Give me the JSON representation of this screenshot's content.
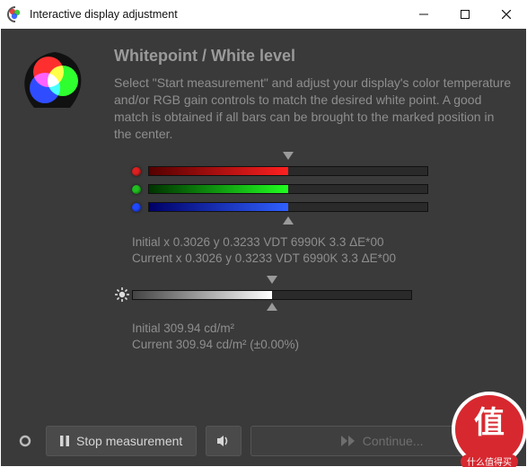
{
  "window": {
    "title": "Interactive display adjustment"
  },
  "heading": "Whitepoint / White level",
  "description": "Select \"Start measurement\" and adjust your display's color temperature and/or RGB gain controls to match the desired white point. A good match is obtained if all bars can be brought to the marked position in the center.",
  "rgb_bars": {
    "red_pct": 50,
    "green_pct": 50,
    "blue_pct": 50
  },
  "whitepoint_readings": {
    "initial": "Initial x 0.3026 y 0.3233 VDT 6990K 3.3 ΔE*00",
    "current": "Current x 0.3026 y 0.3233 VDT 6990K 3.3 ΔE*00"
  },
  "luminance_bar": {
    "pct": 50
  },
  "luminance_readings": {
    "initial": "Initial 309.94 cd/m²",
    "current": "Current 309.94 cd/m² (±0.00%)"
  },
  "buttons": {
    "stop": "Stop measurement",
    "continue": "Continue..."
  },
  "watermark": {
    "line1": "值",
    "line2": "什么值得买"
  }
}
